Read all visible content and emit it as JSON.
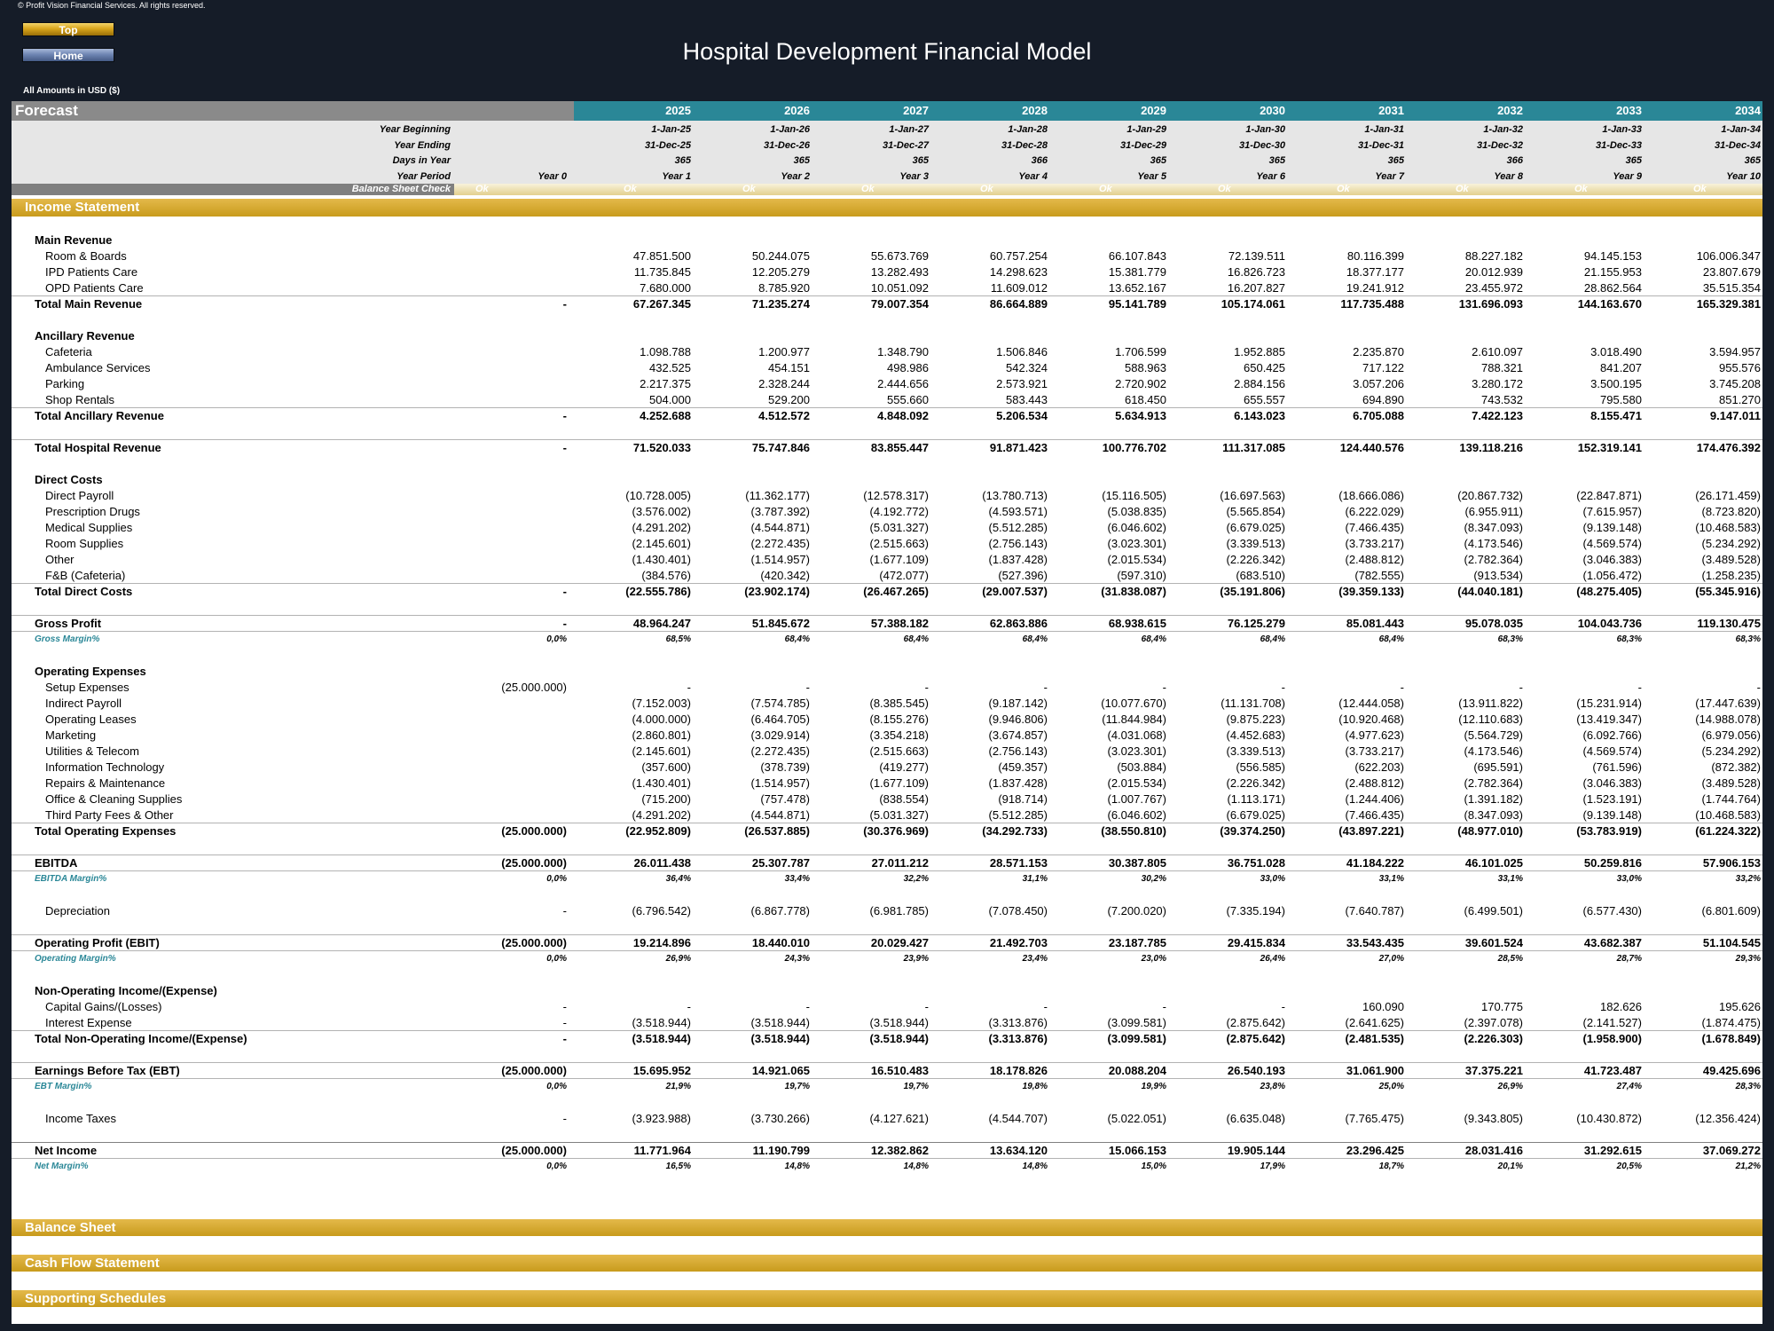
{
  "copyright": "© Profit Vision Financial Services. All rights reserved.",
  "nav": {
    "top_label": "Top",
    "home_label": "Home"
  },
  "title": "Hospital Development Financial Model",
  "amounts_note": "All Amounts in  USD ($)",
  "forecast_label": "Forecast",
  "years": [
    "2025",
    "2026",
    "2027",
    "2028",
    "2029",
    "2030",
    "2031",
    "2032",
    "2033",
    "2034"
  ],
  "meta_rows": [
    {
      "label": "Year Beginning",
      "year0": "",
      "values": [
        "1-Jan-25",
        "1-Jan-26",
        "1-Jan-27",
        "1-Jan-28",
        "1-Jan-29",
        "1-Jan-30",
        "1-Jan-31",
        "1-Jan-32",
        "1-Jan-33",
        "1-Jan-34"
      ]
    },
    {
      "label": "Year Ending",
      "year0": "",
      "values": [
        "31-Dec-25",
        "31-Dec-26",
        "31-Dec-27",
        "31-Dec-28",
        "31-Dec-29",
        "31-Dec-30",
        "31-Dec-31",
        "31-Dec-32",
        "31-Dec-33",
        "31-Dec-34"
      ]
    },
    {
      "label": "Days in Year",
      "year0": "",
      "values": [
        "365",
        "365",
        "365",
        "366",
        "365",
        "365",
        "365",
        "366",
        "365",
        "365"
      ]
    },
    {
      "label": "Year Period",
      "year0": "Year 0",
      "values": [
        "Year 1",
        "Year 2",
        "Year 3",
        "Year 4",
        "Year 5",
        "Year 6",
        "Year 7",
        "Year 8",
        "Year 9",
        "Year 10"
      ]
    }
  ],
  "balance_check": {
    "label": "Balance Sheet Check",
    "values": [
      "Ok",
      "Ok",
      "Ok",
      "Ok",
      "Ok",
      "Ok",
      "Ok",
      "Ok",
      "Ok",
      "Ok",
      "Ok"
    ]
  },
  "sections": {
    "income_statement": "Income Statement",
    "balance_sheet": "Balance Sheet",
    "cash_flow": "Cash Flow Statement",
    "supporting": "Supporting Schedules"
  },
  "rows": [
    {
      "type": "header",
      "label": "Main Revenue"
    },
    {
      "type": "item",
      "label": "Room & Boards",
      "year0": "",
      "values": [
        "47.851.500",
        "50.244.075",
        "55.673.769",
        "60.757.254",
        "66.107.843",
        "72.139.511",
        "80.116.399",
        "88.227.182",
        "94.145.153",
        "106.006.347"
      ]
    },
    {
      "type": "item",
      "label": "IPD Patients Care",
      "year0": "",
      "values": [
        "11.735.845",
        "12.205.279",
        "13.282.493",
        "14.298.623",
        "15.381.779",
        "16.826.723",
        "18.377.177",
        "20.012.939",
        "21.155.953",
        "23.807.679"
      ]
    },
    {
      "type": "item",
      "label": "OPD Patients Care",
      "year0": "",
      "values": [
        "7.680.000",
        "8.785.920",
        "10.051.092",
        "11.609.012",
        "13.652.167",
        "16.207.827",
        "19.241.912",
        "23.455.972",
        "28.862.564",
        "35.515.354"
      ]
    },
    {
      "type": "total",
      "label": "Total Main Revenue",
      "year0": "-",
      "values": [
        "67.267.345",
        "71.235.274",
        "79.007.354",
        "86.664.889",
        "95.141.789",
        "105.174.061",
        "117.735.488",
        "131.696.093",
        "144.163.670",
        "165.329.381"
      ]
    },
    {
      "type": "blank"
    },
    {
      "type": "header",
      "label": "Ancillary Revenue"
    },
    {
      "type": "item",
      "label": "Cafeteria",
      "year0": "",
      "values": [
        "1.098.788",
        "1.200.977",
        "1.348.790",
        "1.506.846",
        "1.706.599",
        "1.952.885",
        "2.235.870",
        "2.610.097",
        "3.018.490",
        "3.594.957"
      ]
    },
    {
      "type": "item",
      "label": "Ambulance Services",
      "year0": "",
      "values": [
        "432.525",
        "454.151",
        "498.986",
        "542.324",
        "588.963",
        "650.425",
        "717.122",
        "788.321",
        "841.207",
        "955.576"
      ]
    },
    {
      "type": "item",
      "label": "Parking",
      "year0": "",
      "values": [
        "2.217.375",
        "2.328.244",
        "2.444.656",
        "2.573.921",
        "2.720.902",
        "2.884.156",
        "3.057.206",
        "3.280.172",
        "3.500.195",
        "3.745.208"
      ]
    },
    {
      "type": "item",
      "label": "Shop Rentals",
      "year0": "",
      "values": [
        "504.000",
        "529.200",
        "555.660",
        "583.443",
        "618.450",
        "655.557",
        "694.890",
        "743.532",
        "795.580",
        "851.270"
      ]
    },
    {
      "type": "total",
      "label": "Total Ancillary Revenue",
      "year0": "-",
      "values": [
        "4.252.688",
        "4.512.572",
        "4.848.092",
        "5.206.534",
        "5.634.913",
        "6.143.023",
        "6.705.088",
        "7.422.123",
        "8.155.471",
        "9.147.011"
      ]
    },
    {
      "type": "blank"
    },
    {
      "type": "total",
      "label": "Total Hospital Revenue",
      "year0": "-",
      "values": [
        "71.520.033",
        "75.747.846",
        "83.855.447",
        "91.871.423",
        "100.776.702",
        "111.317.085",
        "124.440.576",
        "139.118.216",
        "152.319.141",
        "174.476.392"
      ]
    },
    {
      "type": "blank"
    },
    {
      "type": "header",
      "label": "Direct Costs"
    },
    {
      "type": "item",
      "label": "Direct Payroll",
      "year0": "",
      "values": [
        "(10.728.005)",
        "(11.362.177)",
        "(12.578.317)",
        "(13.780.713)",
        "(15.116.505)",
        "(16.697.563)",
        "(18.666.086)",
        "(20.867.732)",
        "(22.847.871)",
        "(26.171.459)"
      ]
    },
    {
      "type": "item",
      "label": "Prescription Drugs",
      "year0": "",
      "values": [
        "(3.576.002)",
        "(3.787.392)",
        "(4.192.772)",
        "(4.593.571)",
        "(5.038.835)",
        "(5.565.854)",
        "(6.222.029)",
        "(6.955.911)",
        "(7.615.957)",
        "(8.723.820)"
      ]
    },
    {
      "type": "item",
      "label": "Medical Supplies",
      "year0": "",
      "values": [
        "(4.291.202)",
        "(4.544.871)",
        "(5.031.327)",
        "(5.512.285)",
        "(6.046.602)",
        "(6.679.025)",
        "(7.466.435)",
        "(8.347.093)",
        "(9.139.148)",
        "(10.468.583)"
      ]
    },
    {
      "type": "item",
      "label": "Room Supplies",
      "year0": "",
      "values": [
        "(2.145.601)",
        "(2.272.435)",
        "(2.515.663)",
        "(2.756.143)",
        "(3.023.301)",
        "(3.339.513)",
        "(3.733.217)",
        "(4.173.546)",
        "(4.569.574)",
        "(5.234.292)"
      ]
    },
    {
      "type": "item",
      "label": "Other",
      "year0": "",
      "values": [
        "(1.430.401)",
        "(1.514.957)",
        "(1.677.109)",
        "(1.837.428)",
        "(2.015.534)",
        "(2.226.342)",
        "(2.488.812)",
        "(2.782.364)",
        "(3.046.383)",
        "(3.489.528)"
      ]
    },
    {
      "type": "item",
      "label": "F&B (Cafeteria)",
      "year0": "",
      "values": [
        "(384.576)",
        "(420.342)",
        "(472.077)",
        "(527.396)",
        "(597.310)",
        "(683.510)",
        "(782.555)",
        "(913.534)",
        "(1.056.472)",
        "(1.258.235)"
      ]
    },
    {
      "type": "total",
      "label": "Total Direct Costs",
      "year0": "-",
      "values": [
        "(22.555.786)",
        "(23.902.174)",
        "(26.467.265)",
        "(29.007.537)",
        "(31.838.087)",
        "(35.191.806)",
        "(39.359.133)",
        "(44.040.181)",
        "(48.275.405)",
        "(55.345.916)"
      ]
    },
    {
      "type": "blank"
    },
    {
      "type": "total",
      "label": "Gross Profit",
      "year0": "-",
      "values": [
        "48.964.247",
        "51.845.672",
        "57.388.182",
        "62.863.886",
        "68.938.615",
        "76.125.279",
        "85.081.443",
        "95.078.035",
        "104.043.736",
        "119.130.475"
      ]
    },
    {
      "type": "margin",
      "label": "Gross Margin%",
      "year0": "0,0%",
      "values": [
        "68,5%",
        "68,4%",
        "68,4%",
        "68,4%",
        "68,4%",
        "68,4%",
        "68,4%",
        "68,3%",
        "68,3%",
        "68,3%"
      ]
    },
    {
      "type": "blank"
    },
    {
      "type": "header",
      "label": "Operating Expenses"
    },
    {
      "type": "item",
      "label": "Setup Expenses",
      "year0": "(25.000.000)",
      "values": [
        "-",
        "-",
        "-",
        "-",
        "-",
        "-",
        "-",
        "-",
        "-",
        "-"
      ]
    },
    {
      "type": "item",
      "label": "Indirect Payroll",
      "year0": "",
      "values": [
        "(7.152.003)",
        "(7.574.785)",
        "(8.385.545)",
        "(9.187.142)",
        "(10.077.670)",
        "(11.131.708)",
        "(12.444.058)",
        "(13.911.822)",
        "(15.231.914)",
        "(17.447.639)"
      ]
    },
    {
      "type": "item",
      "label": "Operating Leases",
      "year0": "",
      "values": [
        "(4.000.000)",
        "(6.464.705)",
        "(8.155.276)",
        "(9.946.806)",
        "(11.844.984)",
        "(9.875.223)",
        "(10.920.468)",
        "(12.110.683)",
        "(13.419.347)",
        "(14.988.078)"
      ]
    },
    {
      "type": "item",
      "label": "Marketing",
      "year0": "",
      "values": [
        "(2.860.801)",
        "(3.029.914)",
        "(3.354.218)",
        "(3.674.857)",
        "(4.031.068)",
        "(4.452.683)",
        "(4.977.623)",
        "(5.564.729)",
        "(6.092.766)",
        "(6.979.056)"
      ]
    },
    {
      "type": "item",
      "label": "Utilities & Telecom",
      "year0": "",
      "values": [
        "(2.145.601)",
        "(2.272.435)",
        "(2.515.663)",
        "(2.756.143)",
        "(3.023.301)",
        "(3.339.513)",
        "(3.733.217)",
        "(4.173.546)",
        "(4.569.574)",
        "(5.234.292)"
      ]
    },
    {
      "type": "item",
      "label": "Information Technology",
      "year0": "",
      "values": [
        "(357.600)",
        "(378.739)",
        "(419.277)",
        "(459.357)",
        "(503.884)",
        "(556.585)",
        "(622.203)",
        "(695.591)",
        "(761.596)",
        "(872.382)"
      ]
    },
    {
      "type": "item",
      "label": "Repairs & Maintenance",
      "year0": "",
      "values": [
        "(1.430.401)",
        "(1.514.957)",
        "(1.677.109)",
        "(1.837.428)",
        "(2.015.534)",
        "(2.226.342)",
        "(2.488.812)",
        "(2.782.364)",
        "(3.046.383)",
        "(3.489.528)"
      ]
    },
    {
      "type": "item",
      "label": "Office & Cleaning Supplies",
      "year0": "",
      "values": [
        "(715.200)",
        "(757.478)",
        "(838.554)",
        "(918.714)",
        "(1.007.767)",
        "(1.113.171)",
        "(1.244.406)",
        "(1.391.182)",
        "(1.523.191)",
        "(1.744.764)"
      ]
    },
    {
      "type": "item",
      "label": "Third Party Fees & Other",
      "year0": "",
      "values": [
        "(4.291.202)",
        "(4.544.871)",
        "(5.031.327)",
        "(5.512.285)",
        "(6.046.602)",
        "(6.679.025)",
        "(7.466.435)",
        "(8.347.093)",
        "(9.139.148)",
        "(10.468.583)"
      ]
    },
    {
      "type": "total",
      "label": "Total Operating Expenses",
      "year0": "(25.000.000)",
      "values": [
        "(22.952.809)",
        "(26.537.885)",
        "(30.376.969)",
        "(34.292.733)",
        "(38.550.810)",
        "(39.374.250)",
        "(43.897.221)",
        "(48.977.010)",
        "(53.783.919)",
        "(61.224.322)"
      ]
    },
    {
      "type": "blank"
    },
    {
      "type": "total",
      "label": "EBITDA",
      "year0": "(25.000.000)",
      "values": [
        "26.011.438",
        "25.307.787",
        "27.011.212",
        "28.571.153",
        "30.387.805",
        "36.751.028",
        "41.184.222",
        "46.101.025",
        "50.259.816",
        "57.906.153"
      ]
    },
    {
      "type": "margin",
      "label": "EBITDA Margin%",
      "year0": "0,0%",
      "values": [
        "36,4%",
        "33,4%",
        "32,2%",
        "31,1%",
        "30,2%",
        "33,0%",
        "33,1%",
        "33,1%",
        "33,0%",
        "33,2%"
      ]
    },
    {
      "type": "blank"
    },
    {
      "type": "item",
      "label": "Depreciation",
      "year0": "-",
      "values": [
        "(6.796.542)",
        "(6.867.778)",
        "(6.981.785)",
        "(7.078.450)",
        "(7.200.020)",
        "(7.335.194)",
        "(7.640.787)",
        "(6.499.501)",
        "(6.577.430)",
        "(6.801.609)"
      ]
    },
    {
      "type": "blank"
    },
    {
      "type": "total",
      "label": "Operating Profit (EBIT)",
      "year0": "(25.000.000)",
      "values": [
        "19.214.896",
        "18.440.010",
        "20.029.427",
        "21.492.703",
        "23.187.785",
        "29.415.834",
        "33.543.435",
        "39.601.524",
        "43.682.387",
        "51.104.545"
      ]
    },
    {
      "type": "margin",
      "label": "Operating Margin%",
      "year0": "0,0%",
      "values": [
        "26,9%",
        "24,3%",
        "23,9%",
        "23,4%",
        "23,0%",
        "26,4%",
        "27,0%",
        "28,5%",
        "28,7%",
        "29,3%"
      ]
    },
    {
      "type": "blank"
    },
    {
      "type": "header",
      "label": "Non-Operating Income/(Expense)"
    },
    {
      "type": "item",
      "label": "Capital Gains/(Losses)",
      "year0": "-",
      "values": [
        "-",
        "-",
        "-",
        "-",
        "-",
        "-",
        "160.090",
        "170.775",
        "182.626",
        "195.626"
      ]
    },
    {
      "type": "item",
      "label": "Interest Expense",
      "year0": "-",
      "values": [
        "(3.518.944)",
        "(3.518.944)",
        "(3.518.944)",
        "(3.313.876)",
        "(3.099.581)",
        "(2.875.642)",
        "(2.641.625)",
        "(2.397.078)",
        "(2.141.527)",
        "(1.874.475)"
      ]
    },
    {
      "type": "total",
      "label": "Total Non-Operating Income/(Expense)",
      "year0": "-",
      "values": [
        "(3.518.944)",
        "(3.518.944)",
        "(3.518.944)",
        "(3.313.876)",
        "(3.099.581)",
        "(2.875.642)",
        "(2.481.535)",
        "(2.226.303)",
        "(1.958.900)",
        "(1.678.849)"
      ]
    },
    {
      "type": "blank"
    },
    {
      "type": "total",
      "label": "Earnings Before Tax (EBT)",
      "year0": "(25.000.000)",
      "values": [
        "15.695.952",
        "14.921.065",
        "16.510.483",
        "18.178.826",
        "20.088.204",
        "26.540.193",
        "31.061.900",
        "37.375.221",
        "41.723.487",
        "49.425.696"
      ]
    },
    {
      "type": "margin",
      "label": "EBT Margin%",
      "year0": "0,0%",
      "values": [
        "21,9%",
        "19,7%",
        "19,7%",
        "19,8%",
        "19,9%",
        "23,8%",
        "25,0%",
        "26,9%",
        "27,4%",
        "28,3%"
      ]
    },
    {
      "type": "blank"
    },
    {
      "type": "item",
      "label": "Income Taxes",
      "year0": "-",
      "values": [
        "(3.923.988)",
        "(3.730.266)",
        "(4.127.621)",
        "(4.544.707)",
        "(5.022.051)",
        "(6.635.048)",
        "(7.765.475)",
        "(9.343.805)",
        "(10.430.872)",
        "(12.356.424)"
      ]
    },
    {
      "type": "blank"
    },
    {
      "type": "net",
      "label": "Net Income",
      "year0": "(25.000.000)",
      "values": [
        "11.771.964",
        "11.190.799",
        "12.382.862",
        "13.634.120",
        "15.066.153",
        "19.905.144",
        "23.296.425",
        "28.031.416",
        "31.292.615",
        "37.069.272"
      ]
    },
    {
      "type": "margin",
      "label": "Net Margin%",
      "year0": "0,0%",
      "values": [
        "16,5%",
        "14,8%",
        "14,8%",
        "14,8%",
        "15,0%",
        "17,9%",
        "18,7%",
        "20,1%",
        "20,5%",
        "21,2%"
      ]
    }
  ]
}
